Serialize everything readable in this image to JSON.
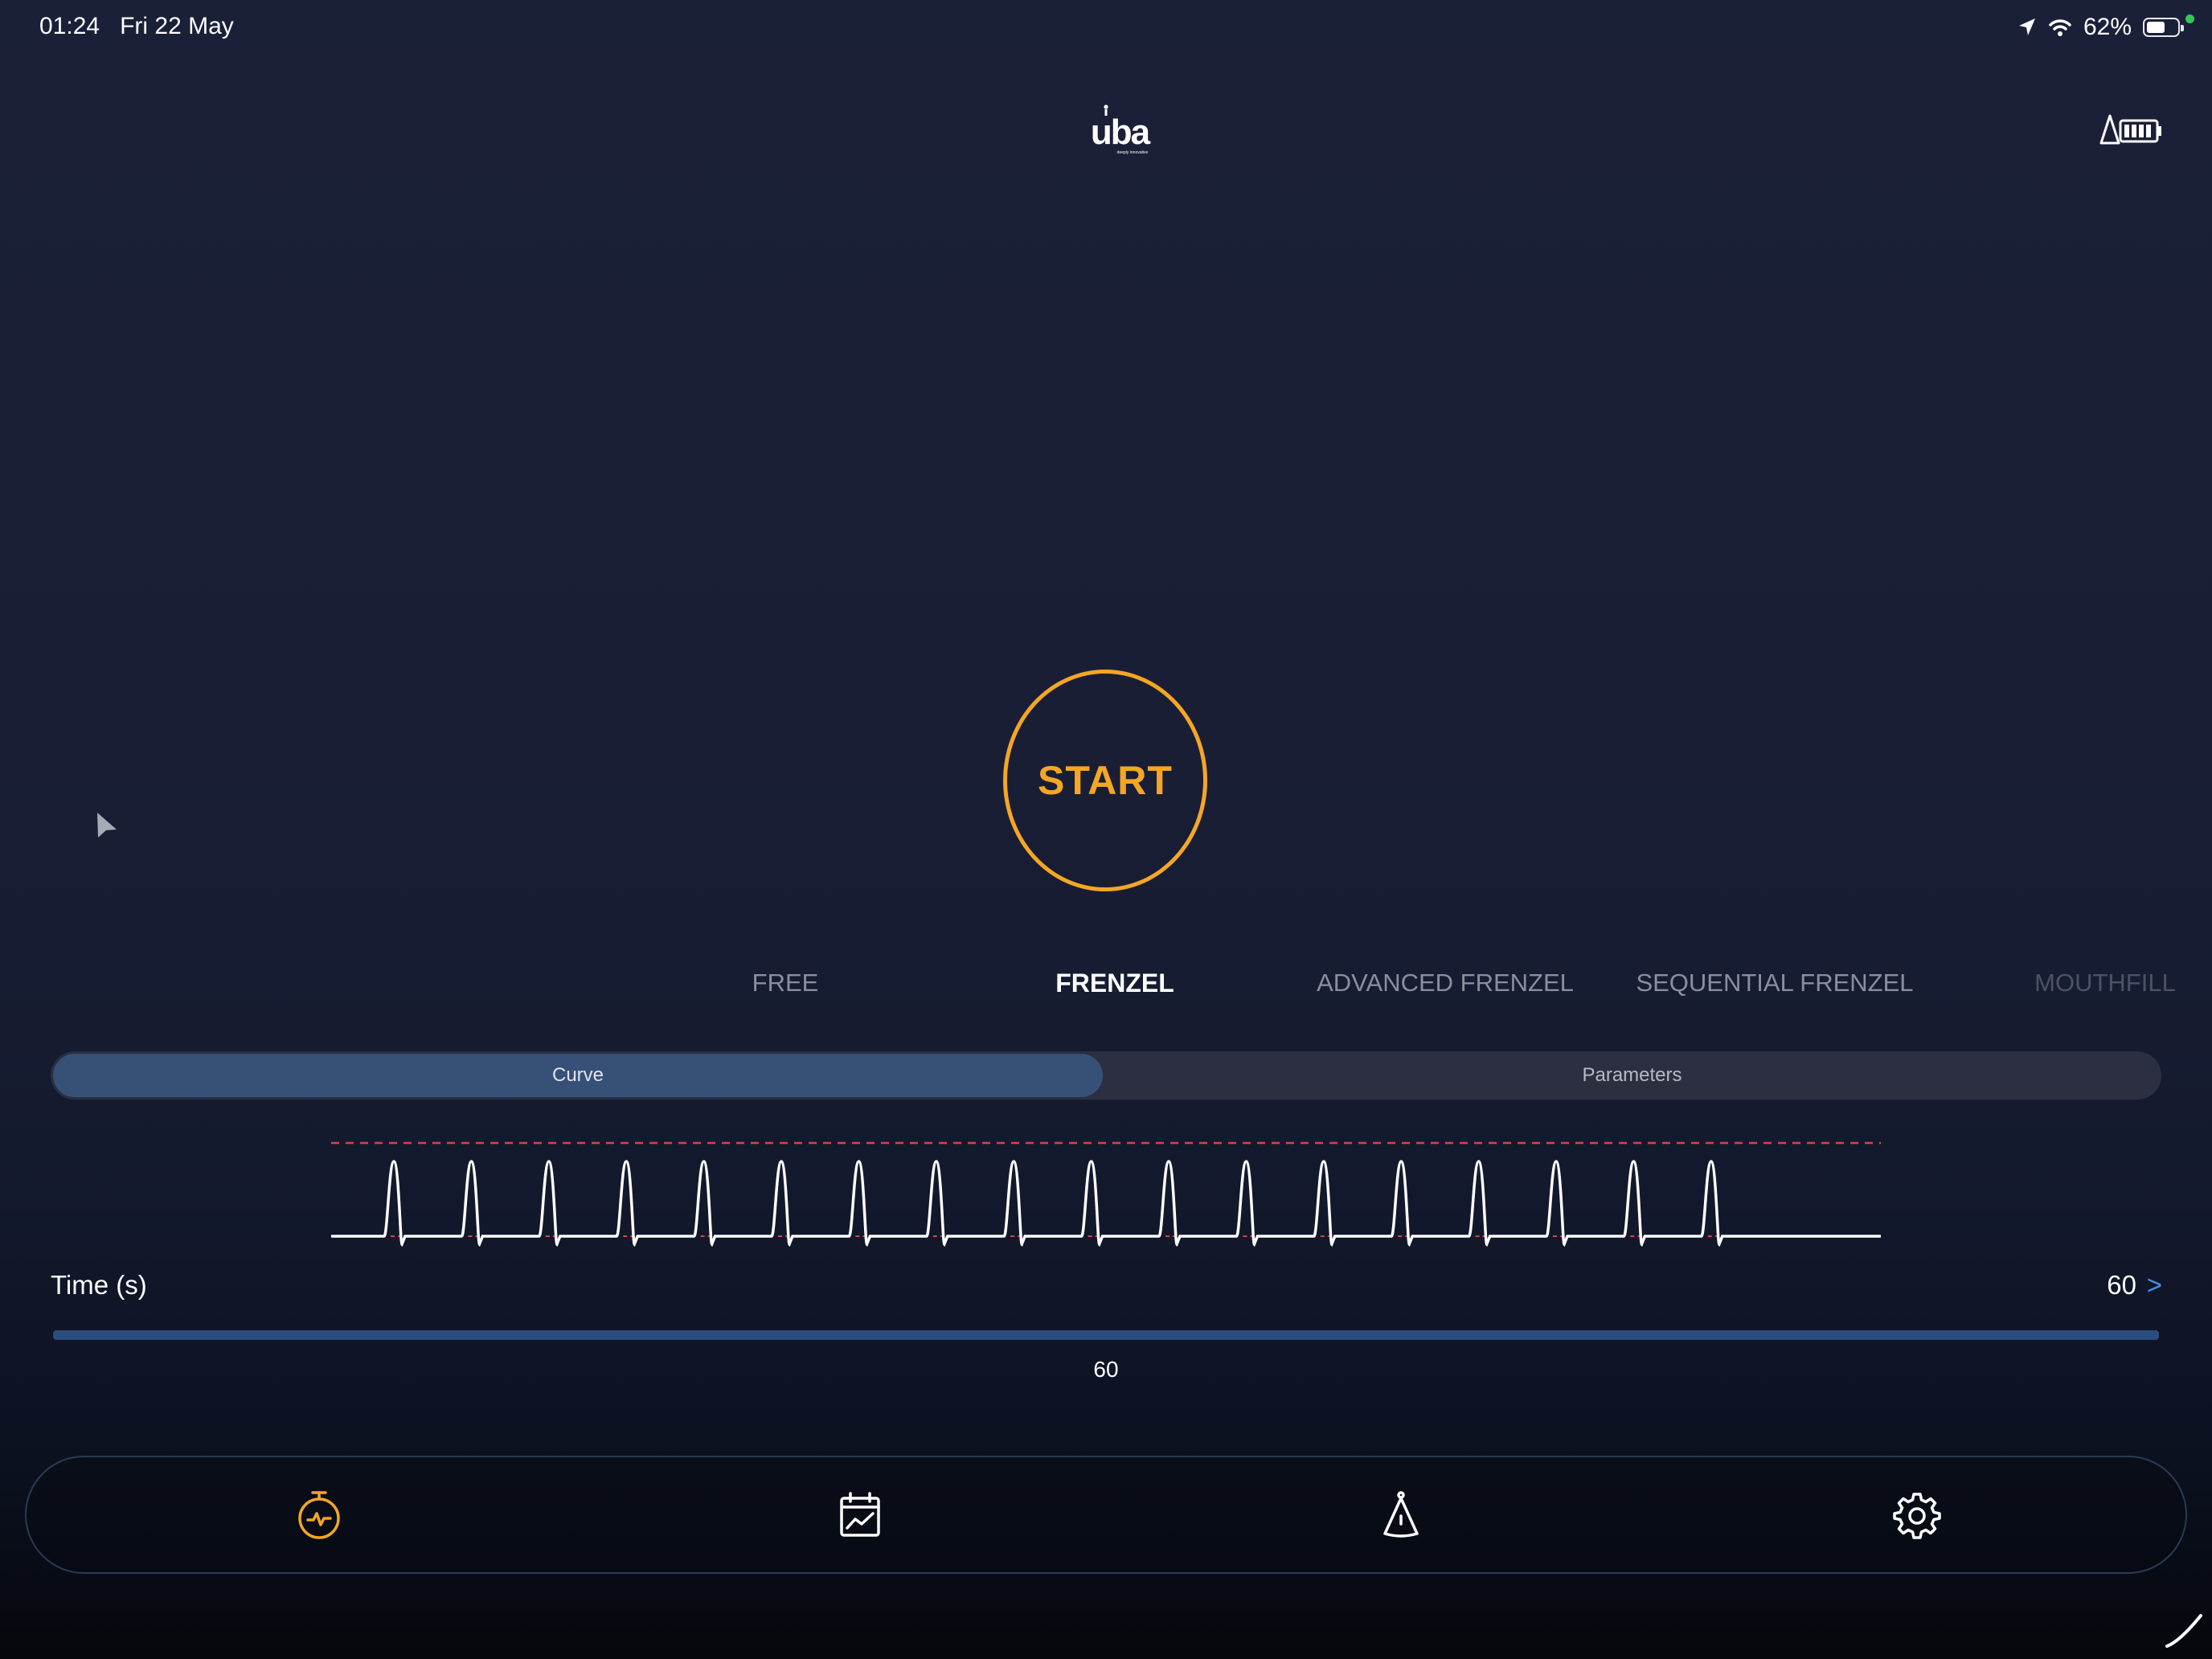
{
  "status_bar": {
    "time": "01:24",
    "date": "Fri 22 May",
    "battery_percent_label": "62%",
    "battery_level": 0.62
  },
  "header": {
    "logo_text": "uba",
    "logo_tagline": "deeply innovative"
  },
  "start_button": {
    "label": "START",
    "color": "#f5a623"
  },
  "modes": [
    {
      "label": "FREE",
      "state": "inactive"
    },
    {
      "label": "FRENZEL",
      "state": "active"
    },
    {
      "label": "ADVANCED FRENZEL",
      "state": "inactive"
    },
    {
      "label": "SEQUENTIAL FRENZEL",
      "state": "inactive"
    },
    {
      "label": "MOUTHFILL",
      "state": "faded"
    }
  ],
  "segmented": {
    "curve_label": "Curve",
    "parameters_label": "Parameters",
    "selected": "Curve"
  },
  "curve": {
    "pulse_count": 18,
    "threshold_color": "#e0403f"
  },
  "time_setting": {
    "label": "Time (s)",
    "value": "60",
    "chevron": ">",
    "slider_value": "60",
    "slider_fraction": 1.0
  },
  "tabbar": {
    "items": [
      {
        "icon": "stopwatch-icon",
        "active": true
      },
      {
        "icon": "calendar-chart-icon",
        "active": false
      },
      {
        "icon": "cone-sensor-icon",
        "active": false
      },
      {
        "icon": "gear-icon",
        "active": false
      }
    ],
    "active_color": "#f5a623",
    "inactive_color": "#ffffff"
  }
}
